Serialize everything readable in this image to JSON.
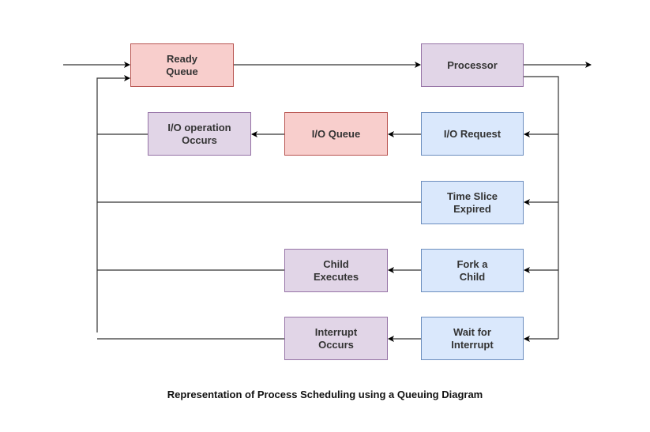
{
  "diagram": {
    "caption": "Representation of Process Scheduling using a Queuing Diagram",
    "colors": {
      "queue_fill": "#f8cecc",
      "queue_border": "#b85450",
      "action_fill": "#e1d5e7",
      "action_border": "#9673a6",
      "event_fill": "#dae8fc",
      "event_border": "#6c8ebf"
    },
    "nodes": {
      "ready_queue": "Ready\nQueue",
      "processor": "Processor",
      "io_request": "I/O Request",
      "io_queue": "I/O Queue",
      "io_operation": "I/O operation\nOccurs",
      "time_slice": "Time Slice\nExpired",
      "fork_child": "Fork a\nChild",
      "child_executes": "Child\nExecutes",
      "wait_interrupt": "Wait for\nInterrupt",
      "interrupt_occurs": "Interrupt\nOccurs"
    },
    "edges": [
      {
        "from": "entry",
        "to": "ready_queue"
      },
      {
        "from": "ready_queue",
        "to": "processor"
      },
      {
        "from": "processor",
        "to": "exit"
      },
      {
        "from": "processor",
        "to": "io_request"
      },
      {
        "from": "processor",
        "to": "time_slice"
      },
      {
        "from": "processor",
        "to": "fork_child"
      },
      {
        "from": "processor",
        "to": "wait_interrupt"
      },
      {
        "from": "io_request",
        "to": "io_queue"
      },
      {
        "from": "io_queue",
        "to": "io_operation"
      },
      {
        "from": "io_operation",
        "to": "ready_queue"
      },
      {
        "from": "time_slice",
        "to": "ready_queue"
      },
      {
        "from": "fork_child",
        "to": "child_executes"
      },
      {
        "from": "child_executes",
        "to": "ready_queue"
      },
      {
        "from": "wait_interrupt",
        "to": "interrupt_occurs"
      },
      {
        "from": "interrupt_occurs",
        "to": "ready_queue"
      }
    ]
  }
}
